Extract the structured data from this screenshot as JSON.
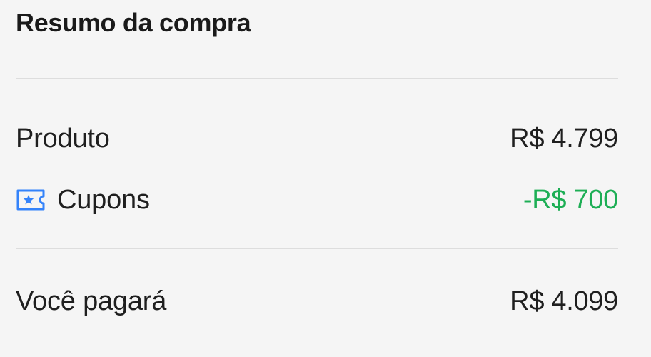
{
  "summary": {
    "title": "Resumo da compra",
    "rows": [
      {
        "label": "Produto",
        "value": "R$ 4.799"
      },
      {
        "label": "Cupons",
        "value": "-R$ 700",
        "icon": "coupon-icon"
      },
      {
        "label": "Você pagará",
        "value": "R$ 4.099"
      }
    ]
  },
  "colors": {
    "background": "#f5f5f5",
    "text": "#1f1f1f",
    "discount": "#1dae55",
    "icon": "#3483fa",
    "divider": "#dddddd"
  }
}
